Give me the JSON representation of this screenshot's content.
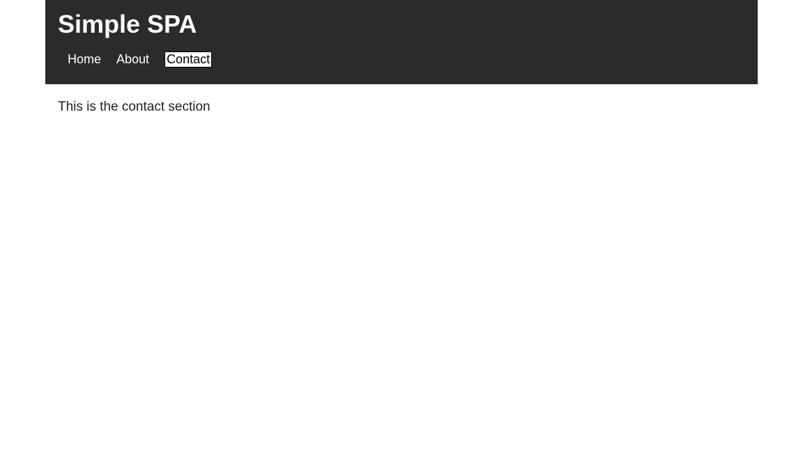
{
  "header": {
    "title": "Simple SPA",
    "nav": {
      "home": "Home",
      "about": "About",
      "contact": "Contact"
    }
  },
  "main": {
    "content_text": "This is the contact section"
  }
}
